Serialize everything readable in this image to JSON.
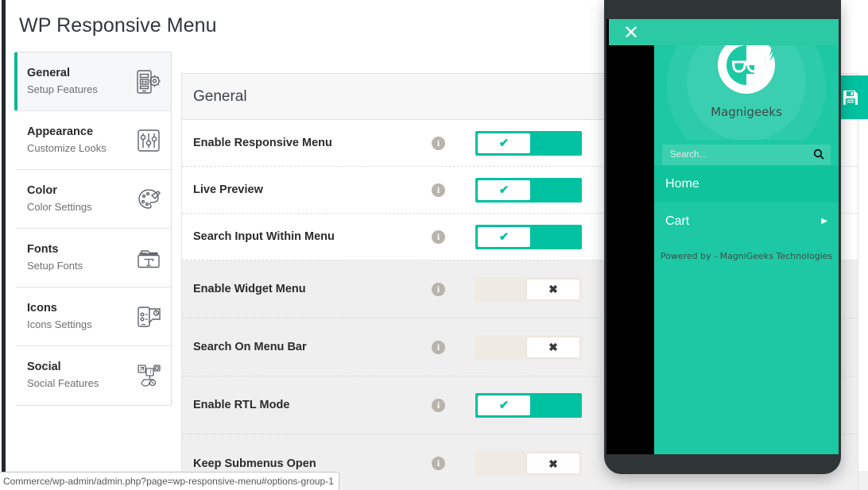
{
  "page": {
    "title": "WP Responsive Menu"
  },
  "sidebar": {
    "items": [
      {
        "title": "General",
        "subtitle": "Setup Features",
        "icon": "phone-gear-icon",
        "active": true
      },
      {
        "title": "Appearance",
        "subtitle": "Customize Looks",
        "icon": "sliders-icon",
        "active": false
      },
      {
        "title": "Color",
        "subtitle": "Color Settings",
        "icon": "palette-icon",
        "active": false
      },
      {
        "title": "Fonts",
        "subtitle": "Setup Fonts",
        "icon": "font-folder-icon",
        "active": false
      },
      {
        "title": "Icons",
        "subtitle": "Icons Settings",
        "icon": "icons-panel-icon",
        "active": false
      },
      {
        "title": "Social",
        "subtitle": "Social Features",
        "icon": "social-share-icon",
        "active": false
      }
    ]
  },
  "panel": {
    "header": "General",
    "info_icon_label": "i",
    "toggle_on_mark": "✔",
    "toggle_off_mark": "✖",
    "rows": [
      {
        "label": "Enable Responsive Menu",
        "state": "on",
        "shaded": false
      },
      {
        "label": "Live Preview",
        "state": "on",
        "shaded": false
      },
      {
        "label": "Search Input Within Menu",
        "state": "on",
        "shaded": false
      },
      {
        "label": "Enable Widget Menu",
        "state": "off",
        "shaded": true
      },
      {
        "label": "Search On Menu Bar",
        "state": "off",
        "shaded": true
      },
      {
        "label": "Enable RTL Mode",
        "state": "on",
        "shaded": true
      },
      {
        "label": "Keep Submenus Open",
        "state": "off",
        "shaded": true
      }
    ]
  },
  "save_button": {
    "label": "save-icon",
    "color": "#00c2a0"
  },
  "preview": {
    "close_label": "✕",
    "brand": "Magnigeeks",
    "search_placeholder": "Search...",
    "search_value": "",
    "search_icon": "search-icon",
    "menu_items": [
      {
        "label": "Home",
        "has_arrow": false,
        "hovered": true
      },
      {
        "label": "Cart",
        "has_arrow": true,
        "hovered": false
      }
    ],
    "submenu_arrow": "▶",
    "powered_by": "Powered by - MagniGeeks Technologies",
    "colors": {
      "header": "#2bc9a4",
      "body": "#1dc9a4",
      "hover": "#0fc39c",
      "bezel": "#2f3437"
    }
  },
  "statusbar": {
    "url": "Commerce/wp-admin/admin.php?page=wp-responsive-menu#options-group-1"
  }
}
